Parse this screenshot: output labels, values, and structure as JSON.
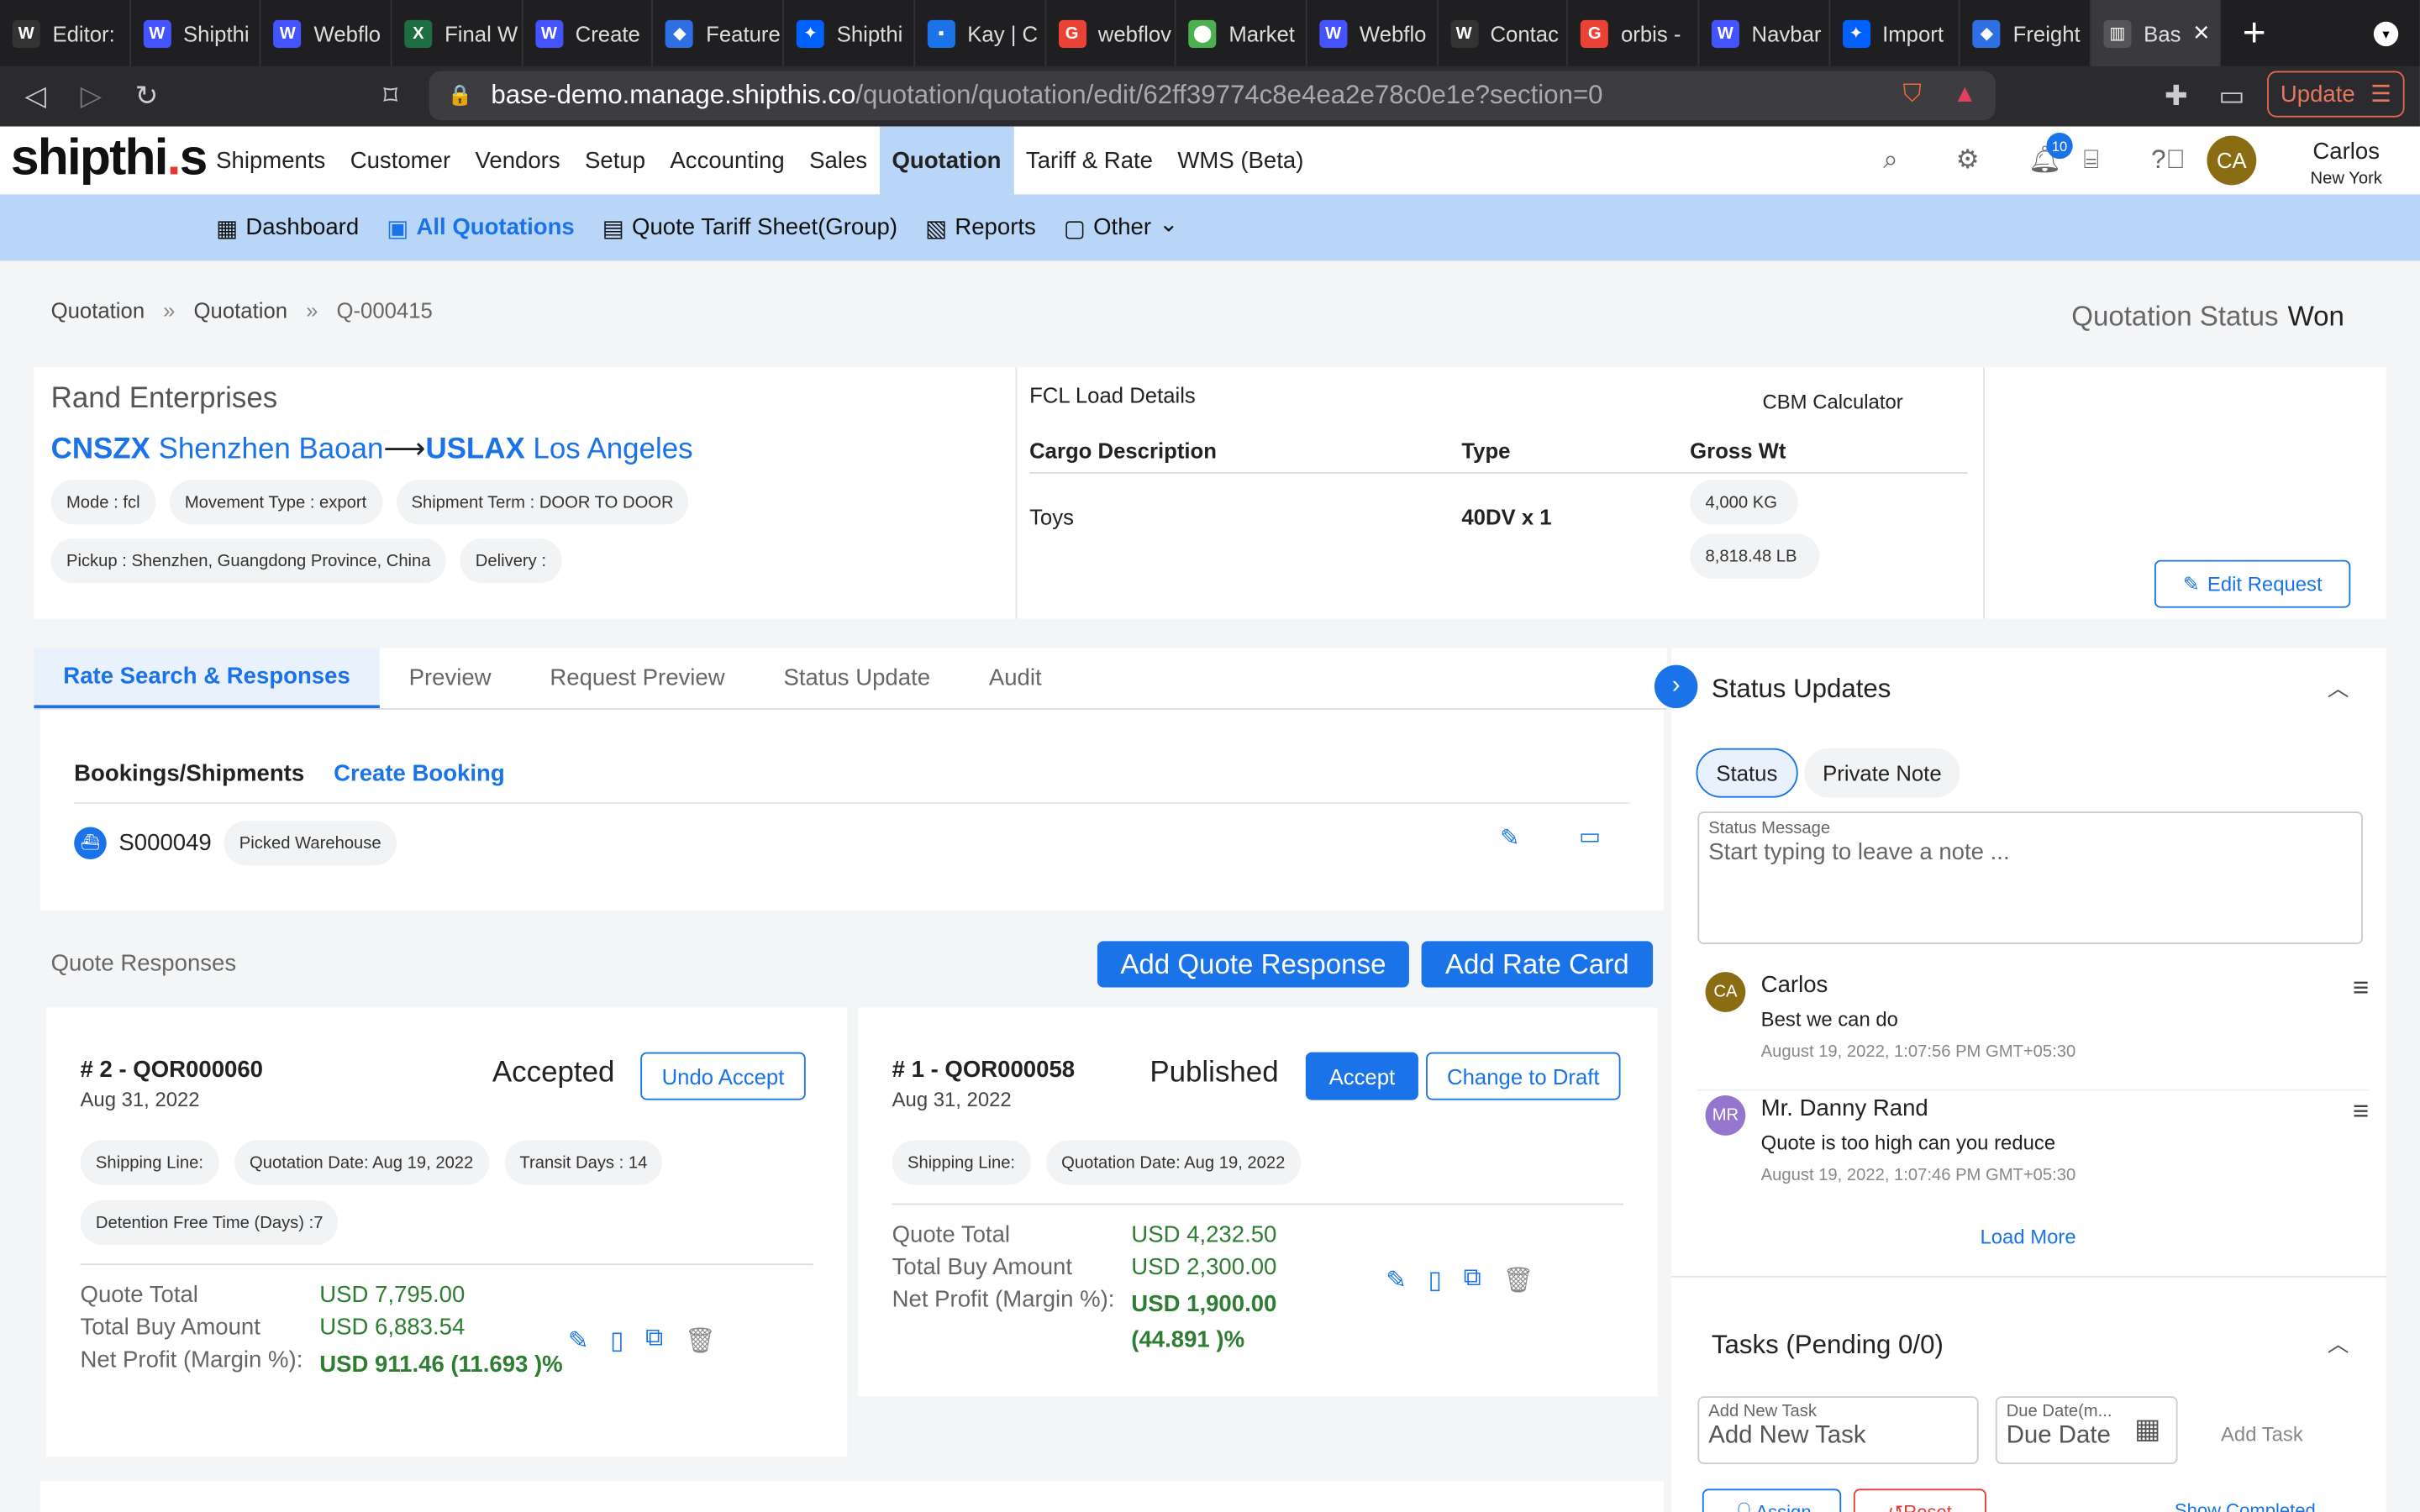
{
  "browser": {
    "tabs": [
      {
        "label": "Editor:",
        "icon": "W",
        "color": "#333"
      },
      {
        "label": "Shipthi",
        "icon": "W",
        "color": "#4353ff"
      },
      {
        "label": "Webflo",
        "icon": "W",
        "color": "#4353ff"
      },
      {
        "label": "Final W",
        "icon": "X",
        "color": "#1d6f42"
      },
      {
        "label": "Create",
        "icon": "W",
        "color": "#4353ff"
      },
      {
        "label": "Feature",
        "icon": "◆",
        "color": "#2f6fe4"
      },
      {
        "label": "Shipthi",
        "icon": "✦",
        "color": "#0061fe"
      },
      {
        "label": "Kay | C",
        "icon": "▪",
        "color": "#1a73e8"
      },
      {
        "label": "webflov",
        "icon": "G",
        "color": "#ea4335"
      },
      {
        "label": "Market",
        "icon": "⬤",
        "color": "#4caf50"
      },
      {
        "label": "Webflo",
        "icon": "W",
        "color": "#4353ff"
      },
      {
        "label": "Contac",
        "icon": "W",
        "color": "#333"
      },
      {
        "label": "orbis -",
        "icon": "G",
        "color": "#ea4335"
      },
      {
        "label": "Navbar",
        "icon": "W",
        "color": "#4353ff"
      },
      {
        "label": "Import",
        "icon": "✦",
        "color": "#0061fe"
      },
      {
        "label": "Freight",
        "icon": "◆",
        "color": "#2f6fe4"
      }
    ],
    "active_tab": {
      "label": "Bas",
      "icon": "▥"
    },
    "url_host": "base-demo.manage.shipthis.co",
    "url_path": "/quotation/quotation/edit/62ff39774c8e4ea2e78c0e1e?section=0",
    "update_label": "Update"
  },
  "app": {
    "logo_main": "shipth",
    "logo_i": "i",
    "logo_end": "s",
    "nav": [
      "Shipments",
      "Customer",
      "Vendors",
      "Setup",
      "Accounting",
      "Sales",
      "Quotation",
      "Tariff & Rate",
      "WMS (Beta)"
    ],
    "active_nav": "Quotation",
    "notification_count": "10",
    "user_initials": "CA",
    "user_name": "Carlos",
    "user_city": "New York",
    "subnav": [
      {
        "label": "Dashboard",
        "icon": "▦"
      },
      {
        "label": "All Quotations",
        "icon": "▣"
      },
      {
        "label": "Quote Tariff Sheet(Group)",
        "icon": "▤"
      },
      {
        "label": "Reports",
        "icon": "▧"
      },
      {
        "label": "Other",
        "icon": "▢"
      }
    ]
  },
  "breadcrumb": [
    "Quotation",
    "Quotation",
    "Q-000415"
  ],
  "quotation_status_label": "Quotation Status",
  "quotation_status_value": "Won",
  "request": {
    "customer": "Rand Enterprises",
    "origin_code": "CNSZX",
    "origin_name": "Shenzhen Baoan",
    "arrow": "⟶",
    "dest_code": "USLAX",
    "dest_name": "Los Angeles",
    "chips": [
      "Mode : fcl",
      "Movement Type : export",
      "Shipment Term : DOOR TO DOOR",
      "Pickup : Shenzhen, Guangdong Province, China",
      "Delivery :"
    ],
    "load_title": "FCL Load Details",
    "cbm_label": "CBM Calculator",
    "headers": [
      "Cargo Description",
      "Type",
      "Gross Wt"
    ],
    "cargo": "Toys",
    "type": "40DV x 1",
    "weights": [
      "4,000 KG",
      "8,818.48 LB"
    ],
    "edit_label": "Edit Request"
  },
  "tabs": [
    "Rate Search & Responses",
    "Preview",
    "Request Preview",
    "Status Update",
    "Audit"
  ],
  "bookings": {
    "title": "Bookings/Shipments",
    "create": "Create Booking",
    "id": "S000049",
    "status": "Picked Warehouse"
  },
  "quote_responses": {
    "title": "Quote Responses",
    "add_quote": "Add Quote Response",
    "add_rate": "Add Rate Card",
    "cards": [
      {
        "title": "# 2 - QOR000060",
        "date": "Aug 31, 2022",
        "status": "Accepted",
        "btn1": "Undo Accept",
        "chips": [
          "Shipping Line:",
          "Quotation Date: Aug 19, 2022",
          "Transit Days : 14",
          "Detention Free Time (Days) :7"
        ],
        "labels": [
          "Quote Total",
          "Total Buy Amount",
          "Net Profit (Margin %):"
        ],
        "quote_total": "USD 7,795.00",
        "buy": "USD 6,883.54",
        "profit": "USD 911.46 (11.693 )%"
      },
      {
        "title": "# 1 - QOR000058",
        "date": "Aug 31, 2022",
        "status": "Published",
        "btn1": "Accept",
        "btn2": "Change to Draft",
        "chips": [
          "Shipping Line:",
          "Quotation Date: Aug 19, 2022"
        ],
        "labels": [
          "Quote Total",
          "Total Buy Amount",
          "Net Profit (Margin %):"
        ],
        "quote_total": "USD 4,232.50",
        "buy": "USD 2,300.00",
        "profit": "USD 1,900.00 (44.891 )%"
      }
    ]
  },
  "status_updates": {
    "title": "Status Updates",
    "btn_status": "Status",
    "btn_note": "Private Note",
    "field_label": "Status Message",
    "placeholder": "Start typing to leave a note ...",
    "notes": [
      {
        "initials": "CA",
        "color": "#8a6d12",
        "name": "Carlos",
        "text": "Best we can do",
        "time": "August 19, 2022, 1:07:56 PM GMT+05:30"
      },
      {
        "initials": "MR",
        "color": "#9575cd",
        "name": "Mr. Danny Rand",
        "text": "Quote is too high can you reduce",
        "time": "August 19, 2022, 1:07:46 PM GMT+05:30"
      }
    ],
    "load_more": "Load More"
  },
  "tasks": {
    "title": "Tasks (Pending 0/0)",
    "new_label": "Add New Task",
    "new_placeholder": "Add New Task",
    "due_label": "Due Date(m...",
    "due_placeholder": "Due Date",
    "add": "Add Task",
    "assign": "Assign",
    "reset": "Reset",
    "show_completed": "Show Completed"
  }
}
